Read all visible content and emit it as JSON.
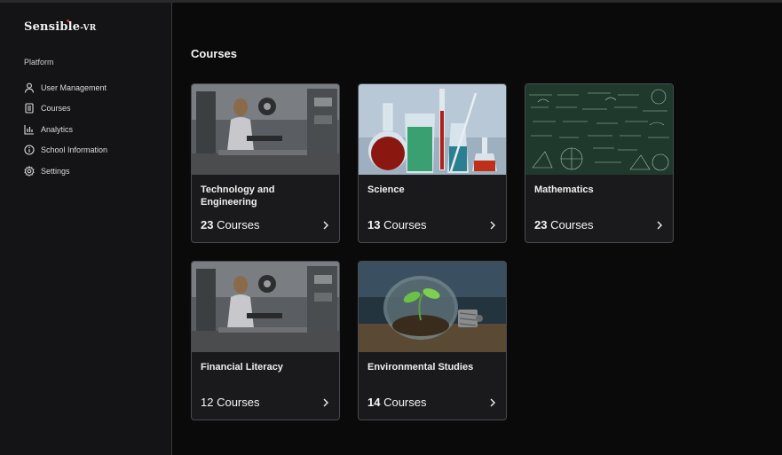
{
  "brand": {
    "name": "Sensible",
    "suffix": "-VR",
    "accent": "#c0302a"
  },
  "sidebar": {
    "section_label": "Platform",
    "items": [
      {
        "label": "User Management",
        "icon": "user-icon"
      },
      {
        "label": "Courses",
        "icon": "document-icon"
      },
      {
        "label": "Analytics",
        "icon": "bar-chart-icon"
      },
      {
        "label": "School Information",
        "icon": "info-icon"
      },
      {
        "label": "Settings",
        "icon": "gear-icon"
      }
    ]
  },
  "main": {
    "title": "Courses",
    "cards": [
      {
        "title": "Technology and Engineering",
        "count": "23",
        "count_label": " Courses",
        "image": "workshop-student-image"
      },
      {
        "title": "Science",
        "count": "13",
        "count_label": " Courses",
        "image": "lab-glassware-image"
      },
      {
        "title": "Mathematics",
        "count": "23",
        "count_label": " Courses",
        "image": "chalkboard-formulas-image"
      },
      {
        "title": "Financial Literacy",
        "count": "12",
        "count_label": " Courses",
        "image": "workshop-student-image"
      },
      {
        "title": "Environmental Studies",
        "count": "14",
        "count_label": " Courses",
        "image": "lightbulb-plant-image"
      }
    ]
  }
}
